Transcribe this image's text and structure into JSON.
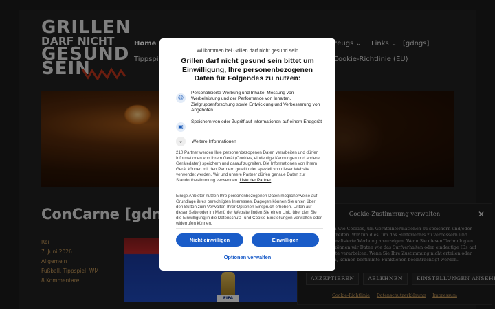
{
  "site": {
    "logo_lines": [
      "GRILLEN",
      "DARF NICHT",
      "GESUND",
      "SEIN"
    ],
    "nav": {
      "home": "Home",
      "tools": "zeugs",
      "tools_chevron": "⌄",
      "links": "Links",
      "links_chevron": "⌄",
      "gdngs": "[gdngs]",
      "tipps": "Tippspiel",
      "cookie": "Cookie-Richtlinie (EU)"
    },
    "post_title": "ConCarne [gdng",
    "post_meta": [
      "Rei",
      "7. Juni 2026",
      "Allgemein",
      "Fußball, Tippspiel, WM",
      "8 Kommentare"
    ],
    "thumb_badge": "FIFA"
  },
  "cmplz": {
    "title": "Cookie-Zustimmung verwalten",
    "close": "✕",
    "text": "Technologien wie Cookies, um Geräteinformationen zu speichern und/oder darauf zuzugreifen. Wir tun dies, um das Surferlebnis zu verbessern und (nicht) personalisierte Werbung anzuzeigen. Wenn Sie diesen Technologien zustimmen, können wir Daten wie das Surfverhalten oder eindeutige IDs auf dieser Website verarbeiten. Wenn Sie Ihre Zustimmung nicht erteilen oder zurückziehen, können bestimmte Funktionen beeinträchtigt werden.",
    "accept": "AKZEPTIEREN",
    "deny": "ABLEHNEN",
    "settings": "EINSTELLUNGEN ANSEHEN",
    "links": [
      "Cookie-Richtlinie",
      "Datenschutzerklärung",
      "Impressum"
    ]
  },
  "consent": {
    "site_title": "Willkommen bei Grillen darf nicht gesund sein",
    "heading": "Grillen darf nicht gesund sein bittet um Einwilligung, Ihre personenbezogenen Daten für Folgendes zu nutzen:",
    "purposes": [
      {
        "icon": "person-icon",
        "glyph": "☺",
        "text": "Personalisierte Werbung und Inhalte, Messung von Werbeleistung und der Performance von Inhalten, Zielgruppenforschung sowie Entwicklung und Verbesserung von Angeboten"
      },
      {
        "icon": "device-icon",
        "glyph": "▣",
        "text": "Speichern von oder Zugriff auf Informationen auf einem Endgerät"
      }
    ],
    "more_info": "Weitere Informationen",
    "more_chevron": "⌄",
    "body1": "210 Partner werden Ihre personenbezogenen Daten verarbeiten und dürfen Informationen von Ihrem Gerät (Cookies, eindeutige Kennungen und andere Gerätedaten) speichern und darauf zugreifen. Die Informationen von Ihrem Gerät können mit den Partnern geteilt oder speziell von dieser Website verwendet werden. Wir und unsere Partner dürfen genaue Daten zur Standortbestimmung verwenden.",
    "partner_link": "Liste der Partner",
    "body2": "Einige Anbieter nutzen Ihre personenbezogenen Daten möglicherweise auf Grundlage ihres berechtigten Interesses. Dagegen können Sie unten über den Button zum Verwalten Ihrer Optionen Einspruch erheben. Unten auf dieser Seite oder im Menü der Website finden Sie einen Link, über den Sie die Einwilligung in die Datenschutz- und Cookie-Einstellungen verwalten oder widerrufen können.",
    "deny": "Nicht einwilligen",
    "accept": "Einwilligen",
    "manage": "Optionen verwalten"
  }
}
